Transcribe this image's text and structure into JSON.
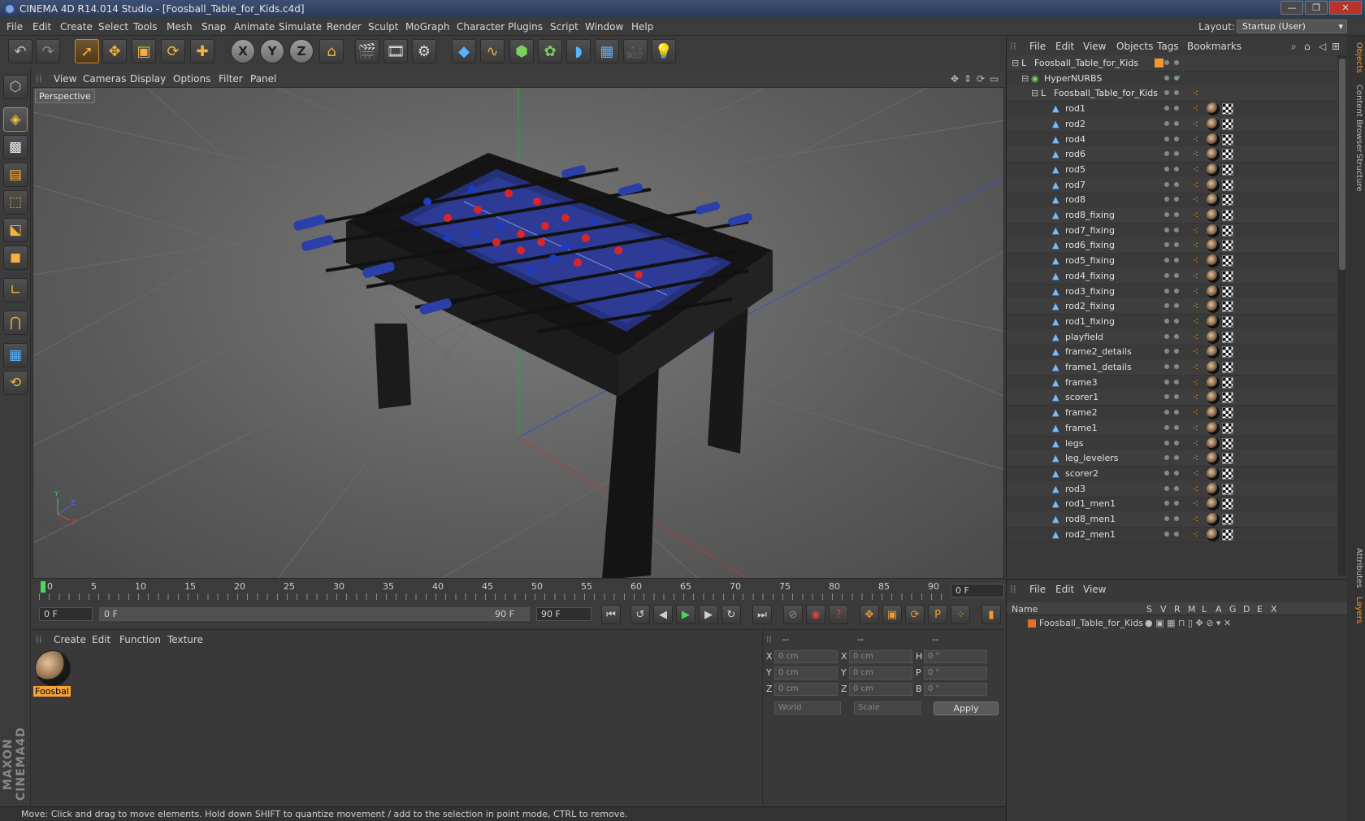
{
  "window": {
    "title": "CINEMA 4D R14.014 Studio - [Foosball_Table_for_Kids.c4d]"
  },
  "menubar": {
    "items": [
      "File",
      "Edit",
      "Create",
      "Select",
      "Tools",
      "Mesh",
      "Snap",
      "Animate",
      "Simulate",
      "Render",
      "Sculpt",
      "MoGraph",
      "Character",
      "Plugins",
      "Script",
      "Window",
      "Help"
    ],
    "layout_label": "Layout:",
    "layout_value": "Startup (User)"
  },
  "viewport": {
    "menu": [
      "View",
      "Cameras",
      "Display",
      "Options",
      "Filter",
      "Panel"
    ],
    "label": "Perspective"
  },
  "timeline": {
    "ticks": [
      "0",
      "5",
      "10",
      "15",
      "20",
      "25",
      "30",
      "35",
      "40",
      "45",
      "50",
      "55",
      "60",
      "65",
      "70",
      "75",
      "80",
      "85",
      "90"
    ],
    "current_frame": "0 F"
  },
  "transport": {
    "start": "0 F",
    "range_start": "0 F",
    "range_end": "90 F",
    "end": "90 F"
  },
  "materials": {
    "menu": [
      "Create",
      "Edit",
      "Function",
      "Texture"
    ],
    "items": [
      {
        "name": "Foosbal"
      }
    ]
  },
  "attributes": {
    "header": [
      "--",
      "--",
      "--"
    ],
    "rows": [
      {
        "a": "X",
        "av": "0 cm",
        "b": "X",
        "bv": "0 cm",
        "c": "H",
        "cv": "0 °"
      },
      {
        "a": "Y",
        "av": "0 cm",
        "b": "Y",
        "bv": "0 cm",
        "c": "P",
        "cv": "0 °"
      },
      {
        "a": "Z",
        "av": "0 cm",
        "b": "Z",
        "bv": "0 cm",
        "c": "B",
        "cv": "0 °"
      }
    ],
    "coord_mode": "World",
    "scale_mode": "Scale",
    "apply": "Apply"
  },
  "objects": {
    "menu": [
      "File",
      "Edit",
      "View",
      "Objects",
      "Tags",
      "Bookmarks"
    ],
    "items": [
      {
        "name": "Foosball_Table_for_Kids",
        "level": 0,
        "type": "null"
      },
      {
        "name": "HyperNURBS",
        "level": 1,
        "type": "nurbs"
      },
      {
        "name": "Foosball_Table_for_Kids",
        "level": 2,
        "type": "null"
      },
      {
        "name": "rod1",
        "level": 3,
        "type": "poly"
      },
      {
        "name": "rod2",
        "level": 3,
        "type": "poly"
      },
      {
        "name": "rod4",
        "level": 3,
        "type": "poly"
      },
      {
        "name": "rod6",
        "level": 3,
        "type": "poly"
      },
      {
        "name": "rod5",
        "level": 3,
        "type": "poly"
      },
      {
        "name": "rod7",
        "level": 3,
        "type": "poly"
      },
      {
        "name": "rod8",
        "level": 3,
        "type": "poly"
      },
      {
        "name": "rod8_fixing",
        "level": 3,
        "type": "poly"
      },
      {
        "name": "rod7_fixing",
        "level": 3,
        "type": "poly"
      },
      {
        "name": "rod6_fixing",
        "level": 3,
        "type": "poly"
      },
      {
        "name": "rod5_fixing",
        "level": 3,
        "type": "poly"
      },
      {
        "name": "rod4_fixing",
        "level": 3,
        "type": "poly"
      },
      {
        "name": "rod3_fixing",
        "level": 3,
        "type": "poly"
      },
      {
        "name": "rod2_fixing",
        "level": 3,
        "type": "poly"
      },
      {
        "name": "rod1_fixing",
        "level": 3,
        "type": "poly"
      },
      {
        "name": "playfield",
        "level": 3,
        "type": "poly"
      },
      {
        "name": "frame2_details",
        "level": 3,
        "type": "poly"
      },
      {
        "name": "frame1_details",
        "level": 3,
        "type": "poly"
      },
      {
        "name": "frame3",
        "level": 3,
        "type": "poly"
      },
      {
        "name": "scorer1",
        "level": 3,
        "type": "poly"
      },
      {
        "name": "frame2",
        "level": 3,
        "type": "poly"
      },
      {
        "name": "frame1",
        "level": 3,
        "type": "poly"
      },
      {
        "name": "legs",
        "level": 3,
        "type": "poly"
      },
      {
        "name": "leg_levelers",
        "level": 3,
        "type": "poly"
      },
      {
        "name": "scorer2",
        "level": 3,
        "type": "poly"
      },
      {
        "name": "rod3",
        "level": 3,
        "type": "poly"
      },
      {
        "name": "rod1_men1",
        "level": 3,
        "type": "poly"
      },
      {
        "name": "rod8_men1",
        "level": 3,
        "type": "poly"
      },
      {
        "name": "rod2_men1",
        "level": 3,
        "type": "poly"
      }
    ]
  },
  "layers": {
    "menu": [
      "File",
      "Edit",
      "View"
    ],
    "columns": [
      "Name",
      "S",
      "V",
      "R",
      "M",
      "L",
      "A",
      "G",
      "D",
      "E",
      "X"
    ],
    "items": [
      {
        "name": "Foosball_Table_for_Kids",
        "color": "#e0702a"
      }
    ]
  },
  "side_tabs": [
    "Objects",
    "Content Browser",
    "Structure",
    "Attributes",
    "Layers"
  ],
  "status": "Move: Click and drag to move elements. Hold down SHIFT to quantize movement / add to the selection in point mode, CTRL to remove.",
  "colors": {
    "accent": "#f39a2a",
    "selection": "#c88a2a",
    "timeline_marker": "#4fd35a"
  }
}
